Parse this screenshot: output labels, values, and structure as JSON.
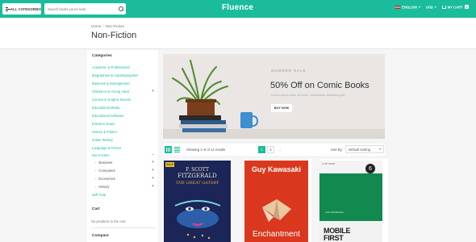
{
  "header": {
    "all_categories_label": "ALL CATEGORIES",
    "search_placeholder": "Search books you're look...",
    "logo": "Fluence",
    "language": "ENGLISH",
    "currency": "USD",
    "cart_label": "MY CART",
    "cart_count": "0",
    "brand_color": "#1abc9c"
  },
  "breadcrumb": {
    "home": "Home",
    "separator": "/",
    "current": "Non-Fiction"
  },
  "page_title": "Non-Fiction",
  "sidebar": {
    "categories_heading": "Categories",
    "categories": [
      "Academic & Professional",
      "Biographies & Autobiographies",
      "Business & Management",
      "Children's & Young Adult",
      "Comics & Graphic Novels",
      "Educational Media",
      "Educational Software",
      "Entrance Exam",
      "History & Politics",
      "Indian Writing",
      "Language & Fiction",
      "Non-Fiction"
    ],
    "subcategories": [
      "Business",
      "Computers",
      "Economics",
      "History"
    ],
    "self_help": "Self Help",
    "cart_heading": "Cart",
    "cart_empty": "No products in the cart.",
    "compare_heading": "Compare"
  },
  "banner": {
    "kicker": "SUMMER SALE",
    "headline": "50% Off on Comic Books",
    "subtext": "Lorem ipsum dolor sit amet, consectetur adipiscing elit.",
    "button": "BUY NOW"
  },
  "toolbar": {
    "showing": "Showing 1–8 of 12 results",
    "pages": [
      "1",
      "2",
      "→"
    ],
    "sort_by_label": "Sort By:",
    "sort_value": "Default sorting"
  },
  "products": [
    {
      "badge": "SALE",
      "author_top": "F. SCOTT",
      "author_bottom": "FITZGERALD",
      "title": "THE GREAT GATSBY"
    },
    {
      "author": "Guy Kawasaki",
      "title": "Enchantment"
    },
    {
      "number": "6",
      "series_small": "A LIST APART",
      "author": "Luke Wroblewski",
      "title_top": "MOBILE",
      "title_bottom": "FIRST"
    }
  ]
}
